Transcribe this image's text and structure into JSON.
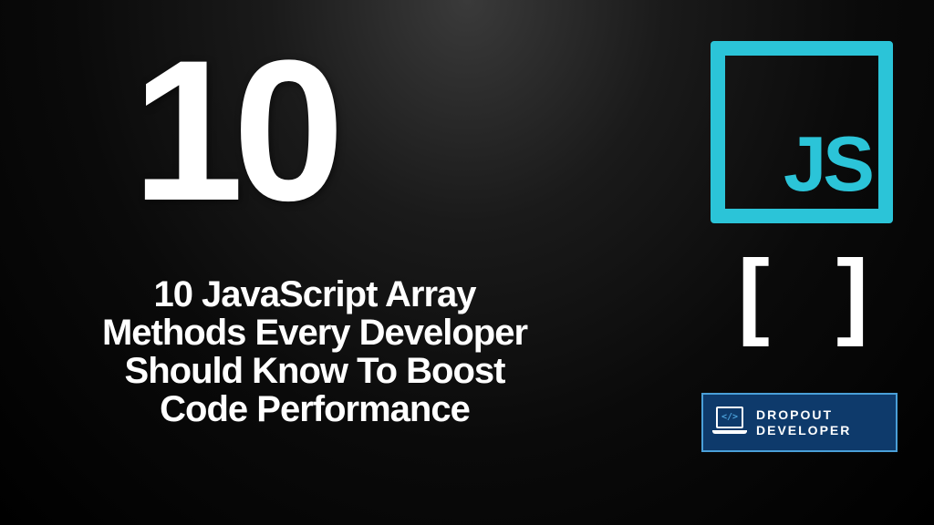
{
  "hero": {
    "number": "10",
    "title": "10 JavaScript Array Methods Every Developer Should Know To Boost Code Performance"
  },
  "logo": {
    "text": "JS"
  },
  "brackets": {
    "text": "[ ]"
  },
  "brand": {
    "code_symbol": "</>",
    "line1": "DROPOUT",
    "line2": "DEVELOPER"
  }
}
